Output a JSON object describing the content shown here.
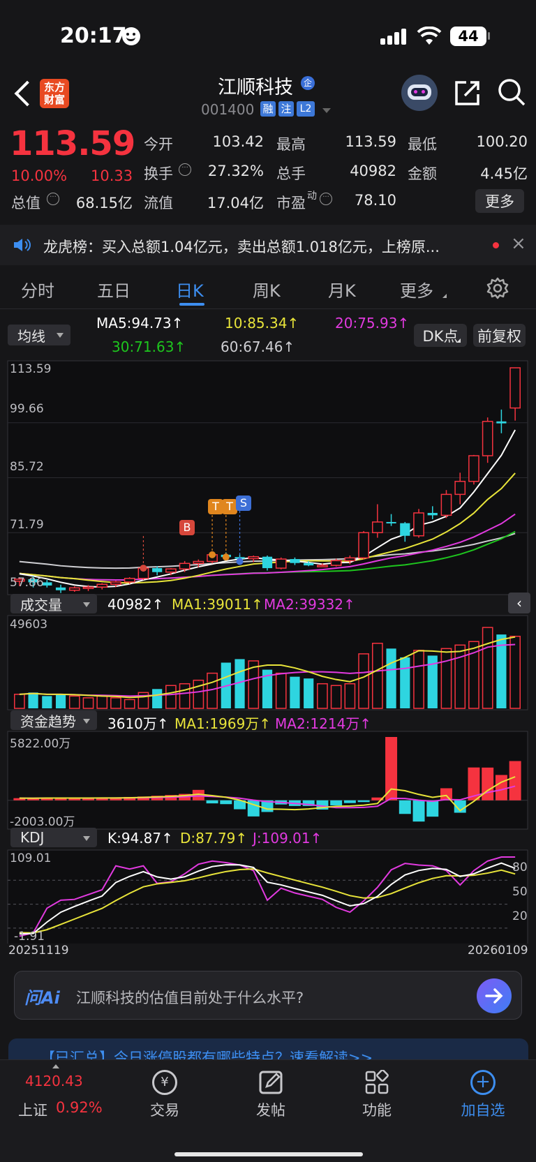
{
  "status_bar": {
    "time": "20:17",
    "battery": "44"
  },
  "header": {
    "logo_line1": "东方",
    "logo_line2": "财富",
    "stock_name": "江顺科技",
    "stock_code": "001400",
    "tags": [
      "融",
      "注",
      "L2"
    ]
  },
  "quote": {
    "price": "113.59",
    "change_pct": "10.00%",
    "change": "10.33",
    "open_label": "今开",
    "open": "103.42",
    "high_label": "最高",
    "high": "113.59",
    "low_label": "最低",
    "low": "100.20",
    "turnover_label": "换手",
    "turnover": "27.32%",
    "volume_label": "总手",
    "volume": "40982",
    "amount_label": "金额",
    "amount": "4.45亿",
    "mktcap_label": "总值",
    "mktcap": "68.15亿",
    "float_label": "流值",
    "float_cap": "17.04亿",
    "pe_label": "市盈",
    "pe_sup": "动",
    "pe": "78.10",
    "more_label": "更多"
  },
  "notice": {
    "text": "龙虎榜：买入总额1.04亿元，卖出总额1.018亿元，上榜原..."
  },
  "tabs": [
    "分时",
    "五日",
    "日K",
    "周K",
    "月K",
    "更多"
  ],
  "active_tab": 2,
  "kline_panel": {
    "selector": "均线",
    "ma5": "MA5:94.73↑",
    "ma10": "10:85.34↑",
    "ma20": "20:75.93↑",
    "ma30": "30:71.63↑",
    "ma60": "60:67.46↑",
    "dk_label": "DK点",
    "adjust_label": "前复权",
    "axis": [
      "113.59",
      "99.66",
      "85.72",
      "71.79",
      "57.86"
    ],
    "markers": [
      "B",
      "T",
      "T",
      "S"
    ]
  },
  "volume_panel": {
    "selector": "成交量",
    "val": "40982↑",
    "ma1": "MA1:39011↑",
    "ma2": "MA2:39332↑",
    "axis_max": "49603"
  },
  "fund_panel": {
    "selector": "资金趋势",
    "val": "3610万↑",
    "ma1": "MA1:1969万↑",
    "ma2": "MA2:1214万↑",
    "axis_max": "5822.00万",
    "axis_min": "-2003.00万"
  },
  "kdj_panel": {
    "selector": "KDJ",
    "k": "K:94.87↑",
    "d": "D:87.79↑",
    "j": "J:109.01↑",
    "axis_max": "109.01",
    "axis_min": "-1.91",
    "levels": [
      "80",
      "50",
      "20"
    ]
  },
  "dates": {
    "start": "20251119",
    "end": "20260109"
  },
  "ai": {
    "logo": "问Ai",
    "question": "江顺科技的估值目前处于什么水平?"
  },
  "banner": {
    "text": "【已汇总】今日涨停股都有哪些特点？速看解读>>"
  },
  "bottom_nav": {
    "index_value": "4120.43",
    "index_name": "上证",
    "index_pct": "0.92%",
    "items": [
      "交易",
      "发帖",
      "功能",
      "加自选"
    ]
  },
  "chart_data": {
    "type": "candlestick",
    "y_range": [
      57.86,
      113.59
    ],
    "candles": [
      [
        59.5,
        60.5,
        58.3,
        60.0
      ],
      [
        60.0,
        60.8,
        57.9,
        59.2
      ],
      [
        59.2,
        59.8,
        57.9,
        58.4
      ],
      [
        57.9,
        58.6,
        56.5,
        57.2
      ],
      [
        57.2,
        58.2,
        56.8,
        57.8
      ],
      [
        57.8,
        58.5,
        57.0,
        58.0
      ],
      [
        58.0,
        59.0,
        57.4,
        58.7
      ],
      [
        58.7,
        59.6,
        58.0,
        59.3
      ],
      [
        59.3,
        60.5,
        58.8,
        60.2
      ],
      [
        60.2,
        63.2,
        59.8,
        62.8
      ],
      [
        62.8,
        63.3,
        61.0,
        61.8
      ],
      [
        61.8,
        62.8,
        61.0,
        62.6
      ],
      [
        62.6,
        64.6,
        61.8,
        64.0
      ],
      [
        64.0,
        65.0,
        63.0,
        64.5
      ],
      [
        64.5,
        66.5,
        64.0,
        66.2
      ],
      [
        66.2,
        66.8,
        65.2,
        65.6
      ],
      [
        65.6,
        66.3,
        64.8,
        65.2
      ],
      [
        65.2,
        66.0,
        64.3,
        65.7
      ],
      [
        65.7,
        66.0,
        62.2,
        62.8
      ],
      [
        62.8,
        65.5,
        62.5,
        65.1
      ],
      [
        65.1,
        65.5,
        63.6,
        64.1
      ],
      [
        64.1,
        64.6,
        63.3,
        63.5
      ],
      [
        63.5,
        64.0,
        63.1,
        63.5
      ],
      [
        63.5,
        65.2,
        63.2,
        64.7
      ],
      [
        64.7,
        66.0,
        63.8,
        65.4
      ],
      [
        65.4,
        72.2,
        65.0,
        71.8
      ],
      [
        71.8,
        79.0,
        70.5,
        74.5
      ],
      [
        74.5,
        76.5,
        73.5,
        74.2
      ],
      [
        74.2,
        74.5,
        69.5,
        71.0
      ],
      [
        71.0,
        77.8,
        70.5,
        76.8
      ],
      [
        76.8,
        78.5,
        75.2,
        76.2
      ],
      [
        76.2,
        82.6,
        75.5,
        81.5
      ],
      [
        81.5,
        87.0,
        79.0,
        84.8
      ],
      [
        84.8,
        91.5,
        84.0,
        91.3
      ],
      [
        91.3,
        101.0,
        89.5,
        100.0
      ],
      [
        100.0,
        103.0,
        97.0,
        99.5
      ],
      [
        103.4,
        113.59,
        100.2,
        113.59
      ]
    ],
    "volume": [
      8,
      9,
      7,
      8,
      7,
      6,
      7,
      6,
      5,
      9,
      11,
      13,
      14,
      16,
      20,
      26,
      28,
      27,
      22,
      20,
      18,
      17,
      14,
      13,
      14,
      31,
      37,
      34,
      29,
      33,
      30,
      34,
      36,
      38,
      46,
      42,
      40.98
    ],
    "fund_flow": [
      200,
      180,
      260,
      210,
      180,
      200,
      230,
      260,
      310,
      350,
      420,
      490,
      590,
      960,
      -280,
      -350,
      -820,
      -1480,
      -1070,
      -380,
      -520,
      -520,
      -850,
      -470,
      -250,
      -160,
      260,
      5822,
      -1250,
      -1950,
      -1500,
      1110,
      -1140,
      3020,
      3010,
      2330,
      3610
    ],
    "kdj_j": [
      10,
      14,
      45,
      55,
      56,
      62,
      68,
      98,
      94,
      98,
      76,
      78,
      88,
      100,
      104,
      102,
      99,
      92,
      55,
      70,
      64,
      60,
      56,
      46,
      40,
      54,
      71,
      93,
      101,
      99,
      98,
      92,
      74,
      92,
      104,
      109,
      109.01
    ]
  }
}
